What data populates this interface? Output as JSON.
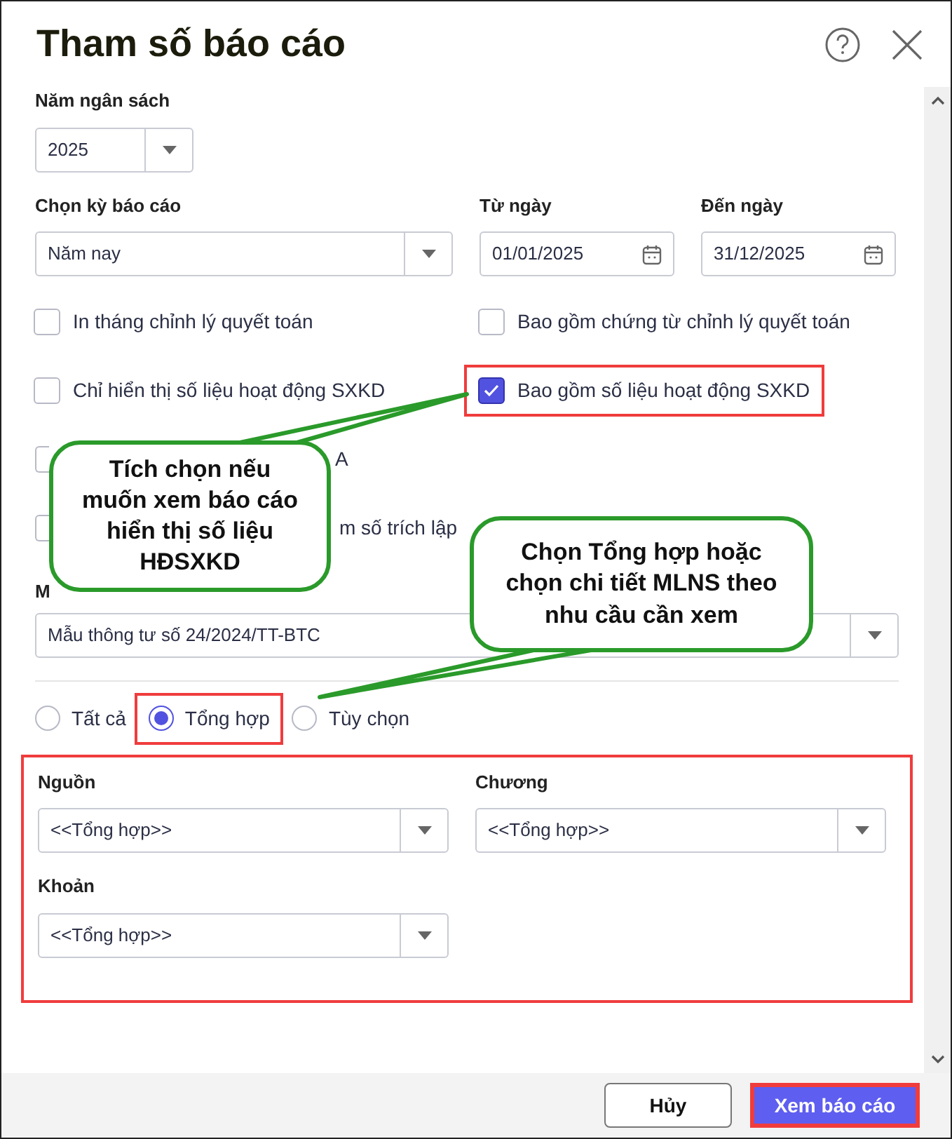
{
  "title": "Tham số báo cáo",
  "budget_year": {
    "label": "Năm ngân sách",
    "value": "2025"
  },
  "period": {
    "label": "Chọn kỳ báo cáo",
    "value": "Năm nay"
  },
  "from_date": {
    "label": "Từ ngày",
    "value": "01/01/2025"
  },
  "to_date": {
    "label": "Đến ngày",
    "value": "31/12/2025"
  },
  "checkboxes": [
    {
      "label": "In tháng chỉnh lý quyết toán",
      "checked": false,
      "highlighted": false
    },
    {
      "label": "Bao gồm chứng từ chỉnh lý quyết toán",
      "checked": false,
      "highlighted": false
    },
    {
      "label": "Chỉ hiển thị số liệu hoạt động SXKD",
      "checked": false,
      "highlighted": false
    },
    {
      "label": "Bao gồm số liệu hoạt động SXKD",
      "checked": true,
      "highlighted": true
    }
  ],
  "covered_checkboxes": [
    {
      "label": "A",
      "checked": false
    },
    {
      "label": "m số trích lập",
      "checked": false
    }
  ],
  "template": {
    "label": "M",
    "value": "Mẫu thông tư số 24/2024/TT-BTC"
  },
  "radios": [
    {
      "label": "Tất cả",
      "selected": false,
      "highlighted": false
    },
    {
      "label": "Tổng hợp",
      "selected": true,
      "highlighted": true
    },
    {
      "label": "Tùy chọn",
      "selected": false,
      "highlighted": false
    }
  ],
  "filters": [
    {
      "label": "Nguồn",
      "value": "<<Tổng hợp>>"
    },
    {
      "label": "Chương",
      "value": "<<Tổng hợp>>"
    },
    {
      "label": "Khoản",
      "value": "<<Tổng hợp>>"
    }
  ],
  "buttons": [
    {
      "label": "Hủy",
      "kind": "secondary"
    },
    {
      "label": "Xem báo cáo",
      "kind": "primary"
    }
  ],
  "callouts": [
    {
      "text": "Tích chọn nếu muốn xem báo cáo hiển thị số liệu HĐSXKD"
    },
    {
      "text": "Chọn Tổng hợp hoặc chọn chi tiết MLNS theo nhu cầu cần xem"
    }
  ]
}
